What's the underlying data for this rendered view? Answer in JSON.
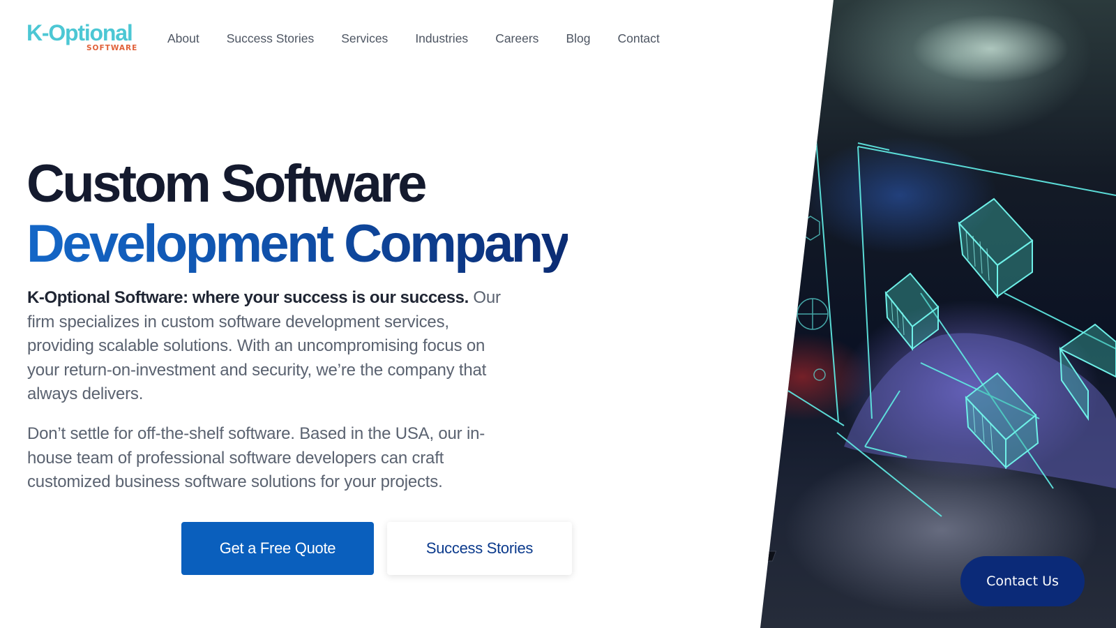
{
  "brand": {
    "logo_main": "K-Optional",
    "logo_sub": "SOFTWARE",
    "primary_color": "#4cc7d4",
    "accent_color": "#e0613a"
  },
  "nav": {
    "items": [
      {
        "label": "About"
      },
      {
        "label": "Success Stories"
      },
      {
        "label": "Services"
      },
      {
        "label": "Industries"
      },
      {
        "label": "Careers"
      },
      {
        "label": "Blog"
      },
      {
        "label": "Contact"
      }
    ]
  },
  "hero": {
    "title_line1": "Custom Software",
    "title_line2": "Development Company",
    "intro_bold": "K-Optional Software: where your success is our success.",
    "intro_rest": " Our firm specializes in custom software development services, providing scalable solutions. With an uncompromising focus on your return-on-investment and security, we’re the company that always delivers.",
    "paragraph2": "Don’t settle for off-the-shelf software. Based in the USA, our in-house team of professional software developers can craft customized business software solutions for your projects.",
    "cta_primary": "Get a Free Quote",
    "cta_secondary": "Success Stories",
    "cta_primary_color": "#0a5fbd"
  },
  "floating": {
    "contact_label": "Contact Us",
    "color": "#0b2a78"
  }
}
